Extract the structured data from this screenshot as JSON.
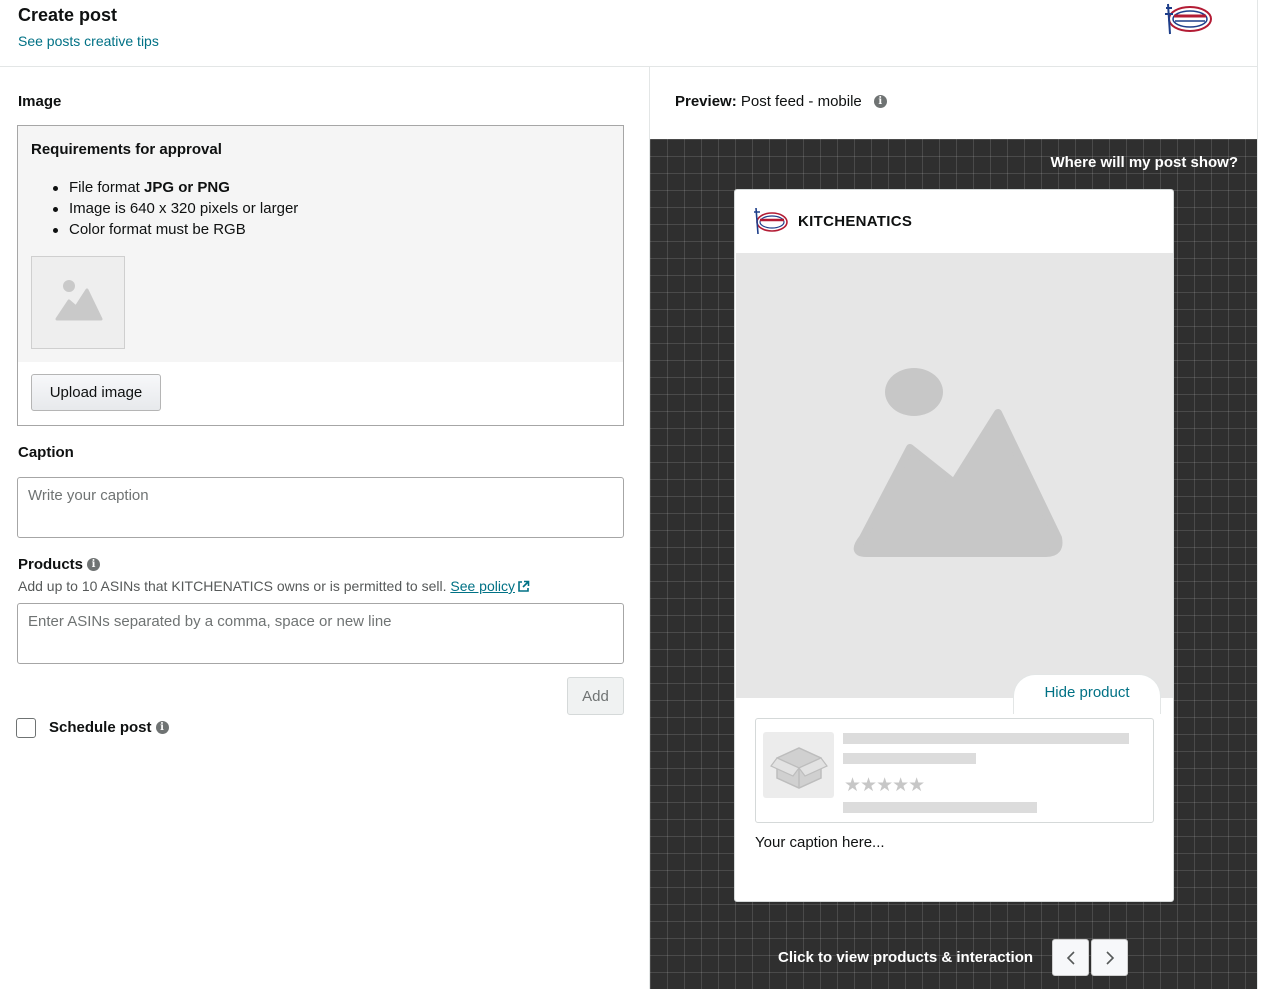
{
  "header": {
    "title": "Create post",
    "tips_link": "See posts creative tips"
  },
  "image_section": {
    "label": "Image",
    "requirements_title": "Requirements for approval",
    "req_1_prefix": "File format ",
    "req_1_bold": "JPG or PNG",
    "req_2": "Image is 640 x 320 pixels or larger",
    "req_3": "Color format must be RGB",
    "upload_button": "Upload image"
  },
  "caption_section": {
    "label": "Caption",
    "placeholder": "Write your caption"
  },
  "products_section": {
    "label": "Products",
    "hint": "Add up to 10 ASINs that KITCHENATICS owns or is permitted to sell. ",
    "policy_link": "See policy",
    "placeholder": "Enter ASINs separated by a comma, space or new line",
    "add_button": "Add"
  },
  "schedule": {
    "label": "Schedule post",
    "checked": false
  },
  "preview": {
    "label": "Preview:",
    "mode": "Post feed - mobile",
    "where_link": "Where will my post show?",
    "brand_name": "KITCHENATICS",
    "hide_product": "Hide product",
    "caption_placeholder": "Your caption here...",
    "footer_text": "Click to view products & interaction"
  },
  "colors": {
    "link": "#007185",
    "preview_bg": "#2f2f2f",
    "placeholder_gray": "#e6e6e6"
  }
}
